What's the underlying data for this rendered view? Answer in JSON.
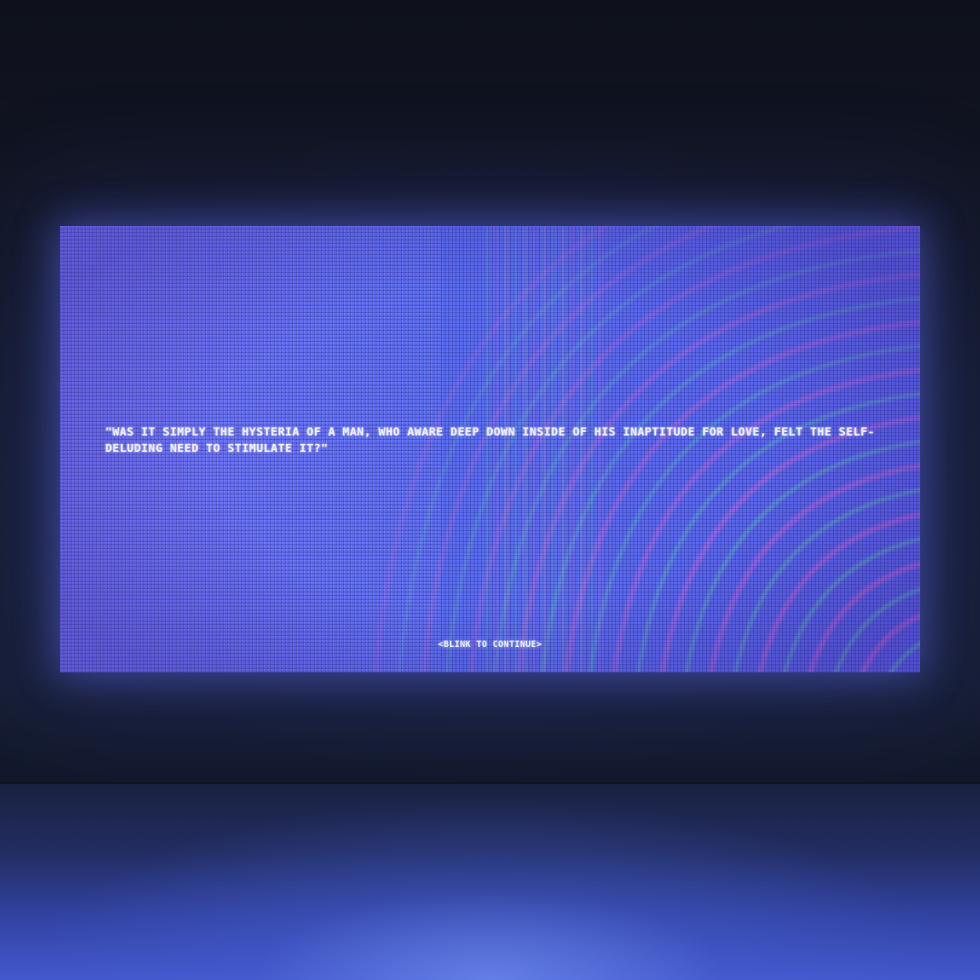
{
  "screen": {
    "quote": "\"WAS IT SIMPLY THE HYSTERIA OF A MAN, WHO AWARE DEEP DOWN INSIDE OF HIS INAPTITUDE FOR LOVE, FELT THE SELF-DELUDING NEED TO STIMULATE IT?\"",
    "continue_prompt": "<BLINK TO CONTINUE>"
  },
  "colors": {
    "screen_base": "#5566ee",
    "contour_pink": "#e86bd8",
    "contour_green": "#5fe0b0",
    "text": "#eef0ff",
    "room_dark": "#0e111b",
    "floor_glow": "#4358cc"
  }
}
